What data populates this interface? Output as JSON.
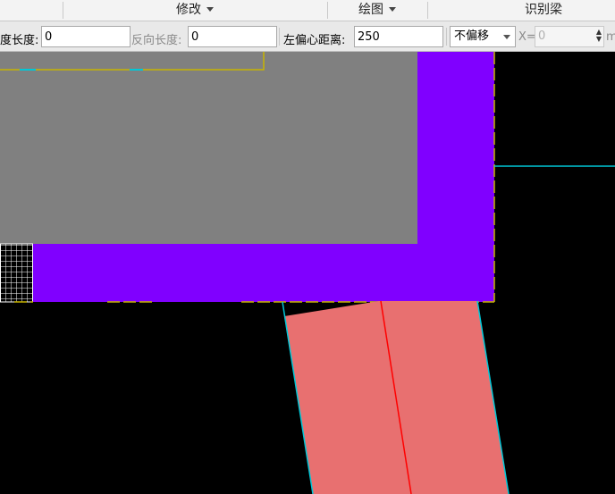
{
  "menubar": {
    "modify": "修改",
    "draw": "绘图",
    "identify_beam": "识别梁"
  },
  "propbar": {
    "length_label_partial": "度长度:",
    "length_value": "0",
    "reverse_length_label": "反向长度:",
    "reverse_length_value": "0",
    "left_offset_label": "左偏心距离:",
    "left_offset_value": "250",
    "offset_mode_value": "不偏移",
    "x_label": "X=",
    "x_value": "0",
    "unit_partial": "m"
  },
  "colors": {
    "wall_purple": "#8000ff",
    "gray_slab": "#808080",
    "salmon_beam": "#e87070",
    "cyan_axis": "#00c8d8",
    "yellow_edge": "#c8b400",
    "red_centerline": "#ff0000",
    "white_grid": "#ffffff"
  }
}
